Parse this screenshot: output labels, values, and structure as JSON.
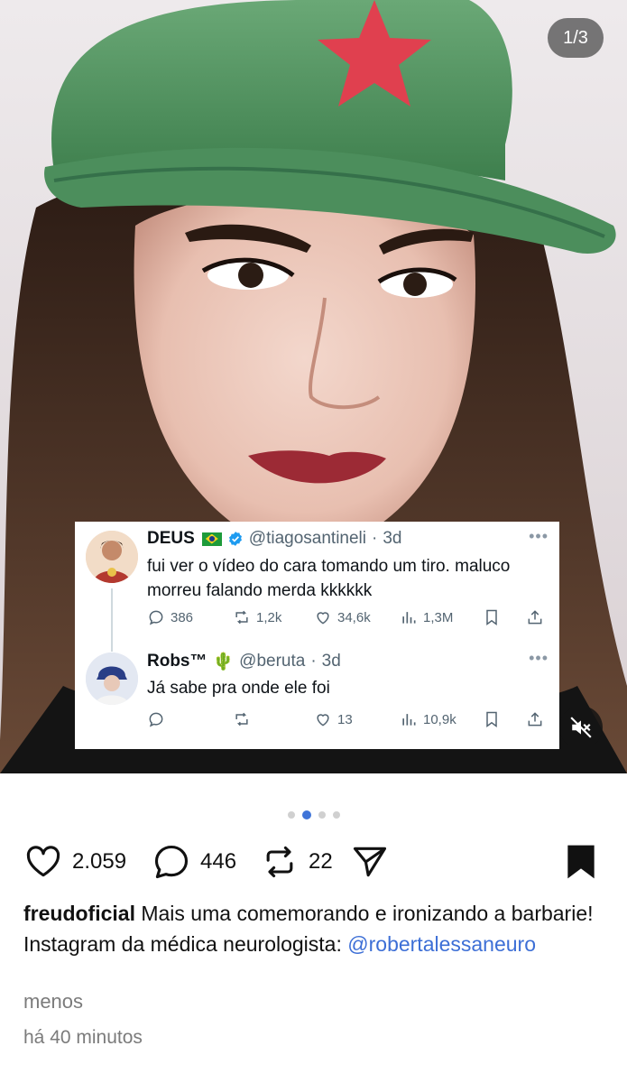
{
  "media": {
    "counter": "1/3",
    "mute_icon": "speaker-muted-icon"
  },
  "tweets": [
    {
      "name": "DEUS",
      "handle": "@tiagosantineli",
      "time": "3d",
      "text": "fui ver o vídeo do cara tomando um tiro. maluco morreu falando merda kkkkkk",
      "replies": "386",
      "retweets": "1,2k",
      "likes": "34,6k",
      "views": "1,3M"
    },
    {
      "name": "Robs™",
      "emoji": "🌵",
      "handle": "@beruta",
      "time": "3d",
      "text": "Já sabe pra onde ele foi",
      "replies": "",
      "retweets": "",
      "likes": "13",
      "views": "10,9k"
    }
  ],
  "carousel": {
    "count": 4,
    "active": 2
  },
  "actions": {
    "likes": "2.059",
    "comments": "446",
    "reposts": "22"
  },
  "caption": {
    "user": "freudoficial",
    "text_line1": " Mais uma comemorando e ironizando a barbarie!",
    "text_line2": "Instagram da médica neurologista: ",
    "mention": "@robertalessaneuro",
    "less": "menos",
    "time": "há 40 minutos"
  },
  "colors": {
    "mention": "#3d6fd6",
    "carousel_active": "#3f74d8",
    "cap_green": "#4f9a60",
    "star_red": "#e0404f"
  }
}
